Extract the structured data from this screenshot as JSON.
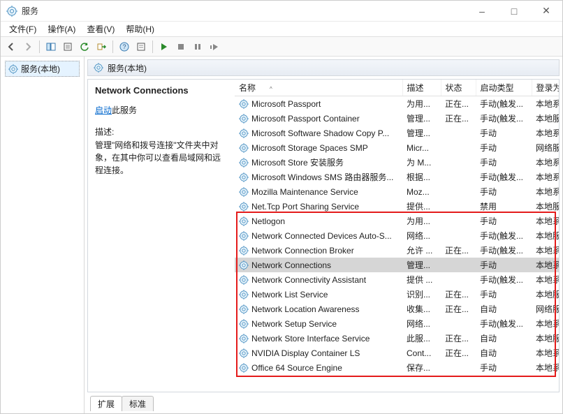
{
  "window": {
    "title": "服务",
    "buttons": {
      "min": "–",
      "max": "□",
      "close": "✕"
    }
  },
  "menu": [
    "文件(F)",
    "操作(A)",
    "查看(V)",
    "帮助(H)"
  ],
  "nav": {
    "root": "服务(本地)"
  },
  "pane_header": "服务(本地)",
  "detail": {
    "selected_name": "Network Connections",
    "start_link": "启动",
    "start_suffix": "此服务",
    "desc_label": "描述:",
    "desc_text": "管理\"网络和拨号连接\"文件夹中对象，在其中你可以查看局域网和远程连接。"
  },
  "columns": {
    "name": "名称",
    "desc": "描述",
    "status": "状态",
    "startup": "启动类型",
    "logon": "登录为"
  },
  "services": [
    {
      "name": "Microsoft Passport",
      "desc": "为用...",
      "status": "正在...",
      "startup": "手动(触发...",
      "logon": "本地系..."
    },
    {
      "name": "Microsoft Passport Container",
      "desc": "管理...",
      "status": "正在...",
      "startup": "手动(触发...",
      "logon": "本地服..."
    },
    {
      "name": "Microsoft Software Shadow Copy P...",
      "desc": "管理...",
      "status": "",
      "startup": "手动",
      "logon": "本地系..."
    },
    {
      "name": "Microsoft Storage Spaces SMP",
      "desc": "Micr...",
      "status": "",
      "startup": "手动",
      "logon": "网络服..."
    },
    {
      "name": "Microsoft Store 安装服务",
      "desc": "为 M...",
      "status": "",
      "startup": "手动",
      "logon": "本地系..."
    },
    {
      "name": "Microsoft Windows SMS 路由器服务...",
      "desc": "根据...",
      "status": "",
      "startup": "手动(触发...",
      "logon": "本地系..."
    },
    {
      "name": "Mozilla Maintenance Service",
      "desc": "Moz...",
      "status": "",
      "startup": "手动",
      "logon": "本地系..."
    },
    {
      "name": "Net.Tcp Port Sharing Service",
      "desc": "提供...",
      "status": "",
      "startup": "禁用",
      "logon": "本地服..."
    },
    {
      "name": "Netlogon",
      "desc": "为用...",
      "status": "",
      "startup": "手动",
      "logon": "本地系..."
    },
    {
      "name": "Network Connected Devices Auto-S...",
      "desc": "网络...",
      "status": "",
      "startup": "手动(触发...",
      "logon": "本地服..."
    },
    {
      "name": "Network Connection Broker",
      "desc": "允许 ...",
      "status": "正在...",
      "startup": "手动(触发...",
      "logon": "本地系..."
    },
    {
      "name": "Network Connections",
      "desc": "管理...",
      "status": "",
      "startup": "手动",
      "logon": "本地系...",
      "selected": true
    },
    {
      "name": "Network Connectivity Assistant",
      "desc": "提供 ...",
      "status": "",
      "startup": "手动(触发...",
      "logon": "本地系..."
    },
    {
      "name": "Network List Service",
      "desc": "识别...",
      "status": "正在...",
      "startup": "手动",
      "logon": "本地服..."
    },
    {
      "name": "Network Location Awareness",
      "desc": "收集...",
      "status": "正在...",
      "startup": "自动",
      "logon": "网络服..."
    },
    {
      "name": "Network Setup Service",
      "desc": "网络...",
      "status": "",
      "startup": "手动(触发...",
      "logon": "本地系..."
    },
    {
      "name": "Network Store Interface Service",
      "desc": "此服...",
      "status": "正在...",
      "startup": "自动",
      "logon": "本地服..."
    },
    {
      "name": "NVIDIA Display Container LS",
      "desc": "Cont...",
      "status": "正在...",
      "startup": "自动",
      "logon": "本地系..."
    },
    {
      "name": "Office 64 Source Engine",
      "desc": "保存...",
      "status": "",
      "startup": "手动",
      "logon": "本地系..."
    }
  ],
  "tabs": {
    "extended": "扩展",
    "standard": "标准"
  },
  "highlight": {
    "top_index": 8,
    "bottom_index": 18
  }
}
